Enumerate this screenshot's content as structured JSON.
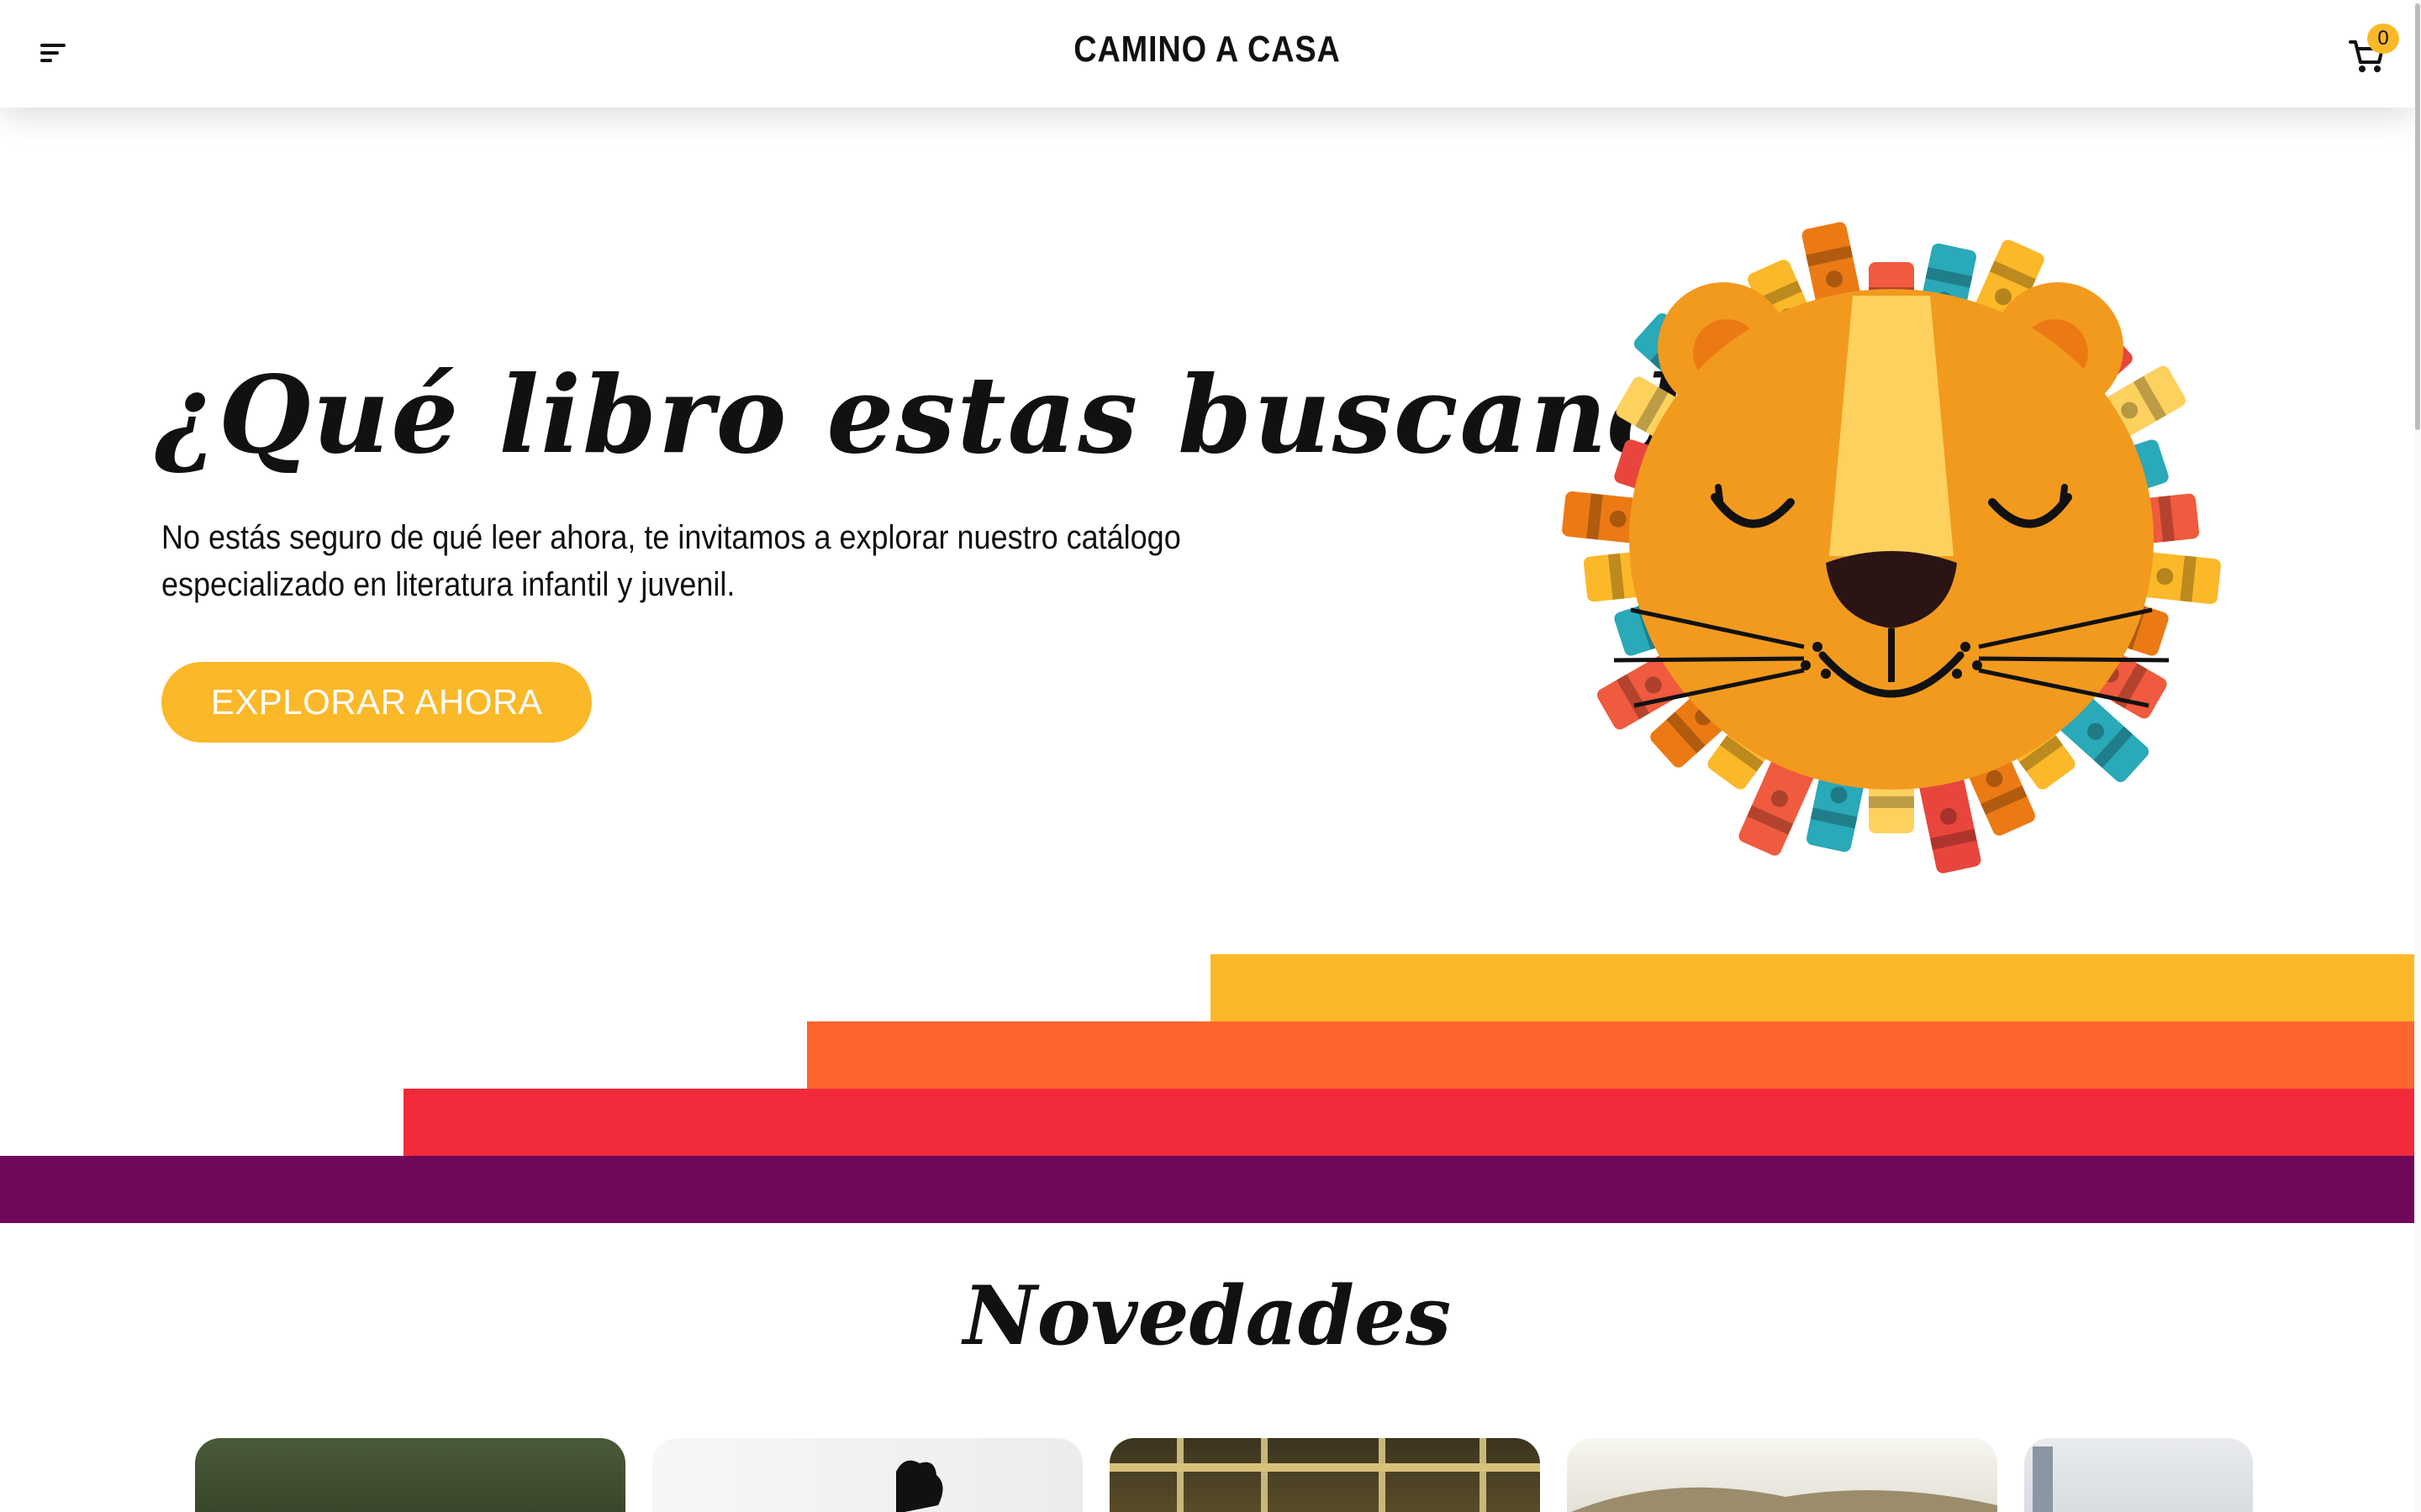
{
  "header": {
    "brand": "CAMINO A CASA",
    "cart_count": "0",
    "menu_icon": "hamburger-icon",
    "cart_icon": "cart-icon"
  },
  "hero": {
    "title": "¿Qué libro estas buscando?",
    "description": "No estás seguro de qué leer ahora, te invitamos a explorar nuestro catálogo especializado en literatura infantil y juvenil.",
    "cta_label": "EXPLORAR AHORA",
    "illustration": "lion-books-illustration"
  },
  "stripes": [
    "#fbb829",
    "#fd652d",
    "#f22b3a",
    "#6f085b"
  ],
  "novedades": {
    "title": "Novedades",
    "cards": [
      "book-card-1",
      "book-card-2",
      "book-card-3",
      "book-card-4",
      "book-card-5"
    ]
  },
  "colors": {
    "accent": "#fbb829",
    "text": "#111111"
  }
}
